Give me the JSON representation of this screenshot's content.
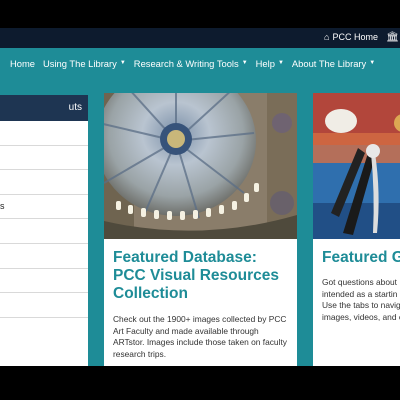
{
  "topbar": {
    "home_link": "PCC Home",
    "home_icon": "home-icon",
    "extra_icon": "bank-icon"
  },
  "nav": {
    "items": [
      {
        "label": "Home",
        "has_menu": false
      },
      {
        "label": "Using The Library",
        "has_menu": true
      },
      {
        "label": "Research & Writing Tools",
        "has_menu": true
      },
      {
        "label": "Help",
        "has_menu": true
      },
      {
        "label": "About The Library",
        "has_menu": true
      }
    ]
  },
  "sidebar": {
    "heading": "uts",
    "items": [
      "",
      "",
      "",
      "s",
      "",
      "",
      "",
      ""
    ]
  },
  "cards": [
    {
      "title": "Featured Database: PCC Visual Resources Collection",
      "body": "Check out the 1900+ images collected by PCC Art Faculty and made available through ARTstor. Images include those taken on faculty research trips."
    },
    {
      "title": "Featured Gu",
      "body_lines": [
        "Got questions about",
        "intended as a startin",
        "Use the tabs to navig",
        "images, videos, and c"
      ]
    }
  ],
  "colors": {
    "teal": "#1e8c97",
    "navy": "#1e3552",
    "topbar": "#0d1b2e"
  }
}
